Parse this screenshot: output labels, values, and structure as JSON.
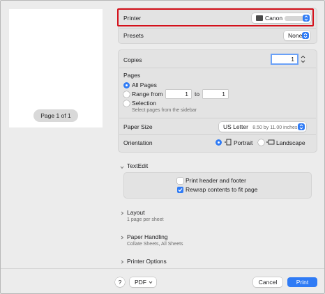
{
  "preview": {
    "page_indicator": "Page 1 of 1"
  },
  "printer": {
    "label": "Printer",
    "value": "Canon"
  },
  "presets": {
    "label": "Presets",
    "value": "None"
  },
  "copies": {
    "label": "Copies",
    "value": "1"
  },
  "pages": {
    "label": "Pages",
    "all_pages": "All Pages",
    "range_from": "Range from",
    "range_from_value": "1",
    "range_to": "to",
    "range_to_value": "1",
    "selection": "Selection",
    "selection_hint": "Select pages from the sidebar"
  },
  "paper_size": {
    "label": "Paper Size",
    "value": "US Letter",
    "dimensions": "8.50 by 11.00 inches"
  },
  "orientation": {
    "label": "Orientation",
    "portrait": "Portrait",
    "landscape": "Landscape"
  },
  "textedit": {
    "label": "TextEdit",
    "print_header_footer": "Print header and footer",
    "rewrap": "Rewrap contents to fit page"
  },
  "layout": {
    "label": "Layout",
    "subtitle": "1 page per sheet"
  },
  "paper_handling": {
    "label": "Paper Handling",
    "subtitle": "Collate Sheets, All Sheets"
  },
  "printer_options": {
    "label": "Printer Options"
  },
  "footer": {
    "help": "?",
    "pdf": "PDF",
    "cancel": "Cancel",
    "print": "Print"
  },
  "colors": {
    "accent": "#2f7bf5",
    "highlight_border": "#d4101a"
  }
}
